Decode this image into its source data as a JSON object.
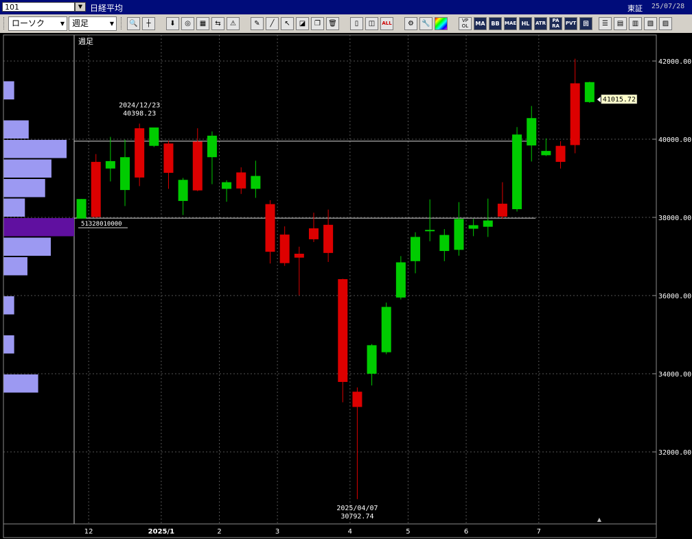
{
  "window": {
    "code": "101",
    "name": "日経平均",
    "market": "東証",
    "date": "25/07/28"
  },
  "toolbar": {
    "chart_type": "ローソク",
    "period": "週足",
    "indicator_buttons": [
      "MA",
      "BB",
      "MAE",
      "HL",
      "ATR",
      "PA RA",
      "PVT",
      "回"
    ]
  },
  "chart_data": {
    "type": "candlestick",
    "period_label": "週足",
    "y_ticks": [
      32000,
      34000,
      36000,
      38000,
      40000,
      42000
    ],
    "y_tick_labels": [
      "32000.00",
      "34000.00",
      "36000.00",
      "38000.00",
      "40000.00",
      "42000.00"
    ],
    "x_ticks": [
      {
        "label": "12",
        "index": 1
      },
      {
        "label": "2025/1",
        "index": 6
      },
      {
        "label": "2",
        "index": 10
      },
      {
        "label": "3",
        "index": 14
      },
      {
        "label": "4",
        "index": 19
      },
      {
        "label": "5",
        "index": 23
      },
      {
        "label": "6",
        "index": 27
      },
      {
        "label": "7",
        "index": 32
      }
    ],
    "colors": {
      "up": "#00cc00",
      "down": "#dd0000",
      "background": "#000000",
      "volume_profile": "#9c99f2",
      "volume_profile_max": "#6010a0",
      "last_price_box": "#ffffcc"
    },
    "candles": [
      {
        "o": 37970,
        "c": 38470,
        "h": 38470,
        "l": 37970
      },
      {
        "o": 39420,
        "c": 38010,
        "h": 39620,
        "l": 37980
      },
      {
        "o": 39250,
        "c": 39440,
        "h": 40060,
        "l": 38920
      },
      {
        "o": 38700,
        "c": 39540,
        "h": 39990,
        "l": 38290
      },
      {
        "o": 40280,
        "c": 39020,
        "h": 40398.23,
        "l": 38800
      },
      {
        "o": 39830,
        "c": 40300,
        "h": 40290,
        "l": 39800
      },
      {
        "o": 39890,
        "c": 39140,
        "h": 39960,
        "l": 38730
      },
      {
        "o": 38420,
        "c": 38960,
        "h": 39010,
        "l": 38060
      },
      {
        "o": 39940,
        "c": 38690,
        "h": 40280,
        "l": 38670
      },
      {
        "o": 39540,
        "c": 40090,
        "h": 40200,
        "l": 38850
      },
      {
        "o": 38730,
        "c": 38900,
        "h": 38950,
        "l": 38400
      },
      {
        "o": 39150,
        "c": 38740,
        "h": 39280,
        "l": 38600
      },
      {
        "o": 38730,
        "c": 39060,
        "h": 39450,
        "l": 38500
      },
      {
        "o": 38340,
        "c": 37120,
        "h": 38440,
        "l": 36820
      },
      {
        "o": 37560,
        "c": 36830,
        "h": 37770,
        "l": 36760
      },
      {
        "o": 37070,
        "c": 36970,
        "h": 37250,
        "l": 36010
      },
      {
        "o": 37720,
        "c": 37440,
        "h": 38120,
        "l": 37370
      },
      {
        "o": 37810,
        "c": 37090,
        "h": 38200,
        "l": 36860
      },
      {
        "o": 36420,
        "c": 33790,
        "h": 36430,
        "l": 33270
      },
      {
        "o": 33540,
        "c": 33150,
        "h": 33650,
        "l": 30792.74
      },
      {
        "o": 34000,
        "c": 34730,
        "h": 34760,
        "l": 33700
      },
      {
        "o": 34550,
        "c": 35710,
        "h": 35820,
        "l": 34500
      },
      {
        "o": 35950,
        "c": 36850,
        "h": 37010,
        "l": 35900
      },
      {
        "o": 36880,
        "c": 37500,
        "h": 37620,
        "l": 36570
      },
      {
        "o": 37660,
        "c": 37680,
        "h": 38460,
        "l": 37390
      },
      {
        "o": 37140,
        "c": 37550,
        "h": 37700,
        "l": 36880
      },
      {
        "o": 37170,
        "c": 37960,
        "h": 38390,
        "l": 37020
      },
      {
        "o": 37710,
        "c": 37800,
        "h": 37960,
        "l": 37520
      },
      {
        "o": 37760,
        "c": 37920,
        "h": 38480,
        "l": 37500
      },
      {
        "o": 38350,
        "c": 38020,
        "h": 38900,
        "l": 37960
      },
      {
        "o": 38210,
        "c": 40120,
        "h": 40310,
        "l": 38150
      },
      {
        "o": 39840,
        "c": 40540,
        "h": 40850,
        "l": 39430
      },
      {
        "o": 39590,
        "c": 39700,
        "h": 40020,
        "l": 39570
      },
      {
        "o": 39830,
        "c": 39420,
        "h": 39950,
        "l": 39250
      },
      {
        "o": 41430,
        "c": 39850,
        "h": 42060,
        "l": 39640
      },
      {
        "o": 40950,
        "c": 41460,
        "h": 41470,
        "l": 40930
      }
    ],
    "annotations": [
      {
        "date": "2024/12/23",
        "value": "40398.23",
        "index": 4,
        "price": 40398.23,
        "position": "above"
      },
      {
        "date": "2025/04/07",
        "value": "30792.74",
        "index": 19,
        "price": 30792.74,
        "position": "below"
      }
    ],
    "horizontal_lines": [
      39950,
      37980
    ],
    "volume_profile_label": "51328010000",
    "volume_profile": [
      {
        "price": 41250,
        "volume": 0.17
      },
      {
        "price": 40250,
        "volume": 0.4
      },
      {
        "price": 39750,
        "volume": 1.0
      },
      {
        "price": 39250,
        "volume": 0.76
      },
      {
        "price": 38750,
        "volume": 0.66
      },
      {
        "price": 38250,
        "volume": 0.34
      },
      {
        "price": 37750,
        "volume": 1.12
      },
      {
        "price": 37250,
        "volume": 0.75
      },
      {
        "price": 36750,
        "volume": 0.38
      },
      {
        "price": 35750,
        "volume": 0.17
      },
      {
        "price": 34750,
        "volume": 0.17
      },
      {
        "price": 33750,
        "volume": 0.55
      }
    ],
    "last_price": 41015.72,
    "last_price_label": "41015.72",
    "scroll_marker": "▲"
  }
}
